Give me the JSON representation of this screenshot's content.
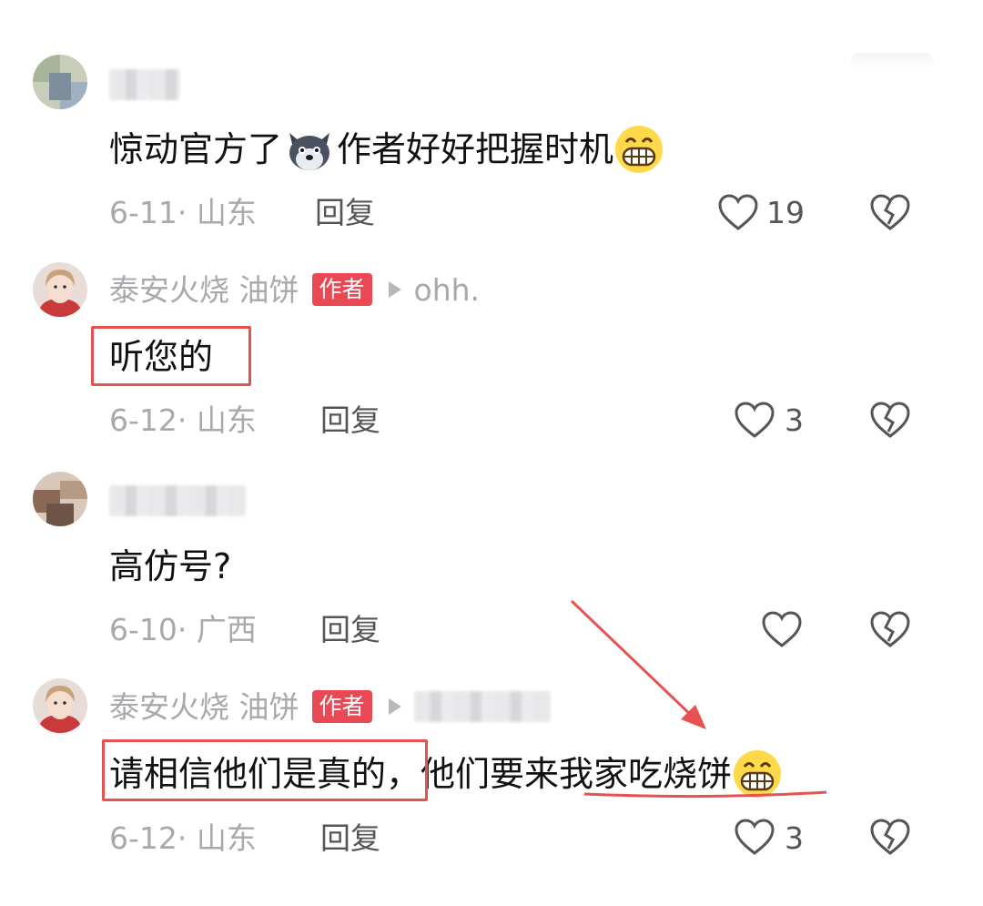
{
  "comments": [
    {
      "date": "6-11· 山东",
      "reply_label": "回复",
      "likes": "19",
      "text_before": "惊动官方了",
      "text_after": "作者好好把握时机"
    },
    {
      "name": "泰安火烧 油饼",
      "badge": "作者",
      "reply_to": "ohh.",
      "text": "听您的",
      "date": "6-12· 山东",
      "reply_label": "回复",
      "likes": "3"
    },
    {
      "text": "高仿号?",
      "date": "6-10· 广西",
      "reply_label": "回复",
      "likes": ""
    },
    {
      "name": "泰安火烧 油饼",
      "badge": "作者",
      "text_part1": "请相信他们是真的",
      "text_part2": "，他们要",
      "text_part3": "来我家吃烧饼",
      "date": "6-12· 山东",
      "reply_label": "回复",
      "likes": "3"
    }
  ],
  "icons": [
    "heart-outline-icon",
    "broken-heart-icon",
    "grinning-emoji",
    "husky-dog-emoji",
    "reply-arrow-icon"
  ],
  "colors": {
    "author_badge": "#e84955",
    "annotation": "#e5524f",
    "meta_gray": "#a9a9ad"
  }
}
